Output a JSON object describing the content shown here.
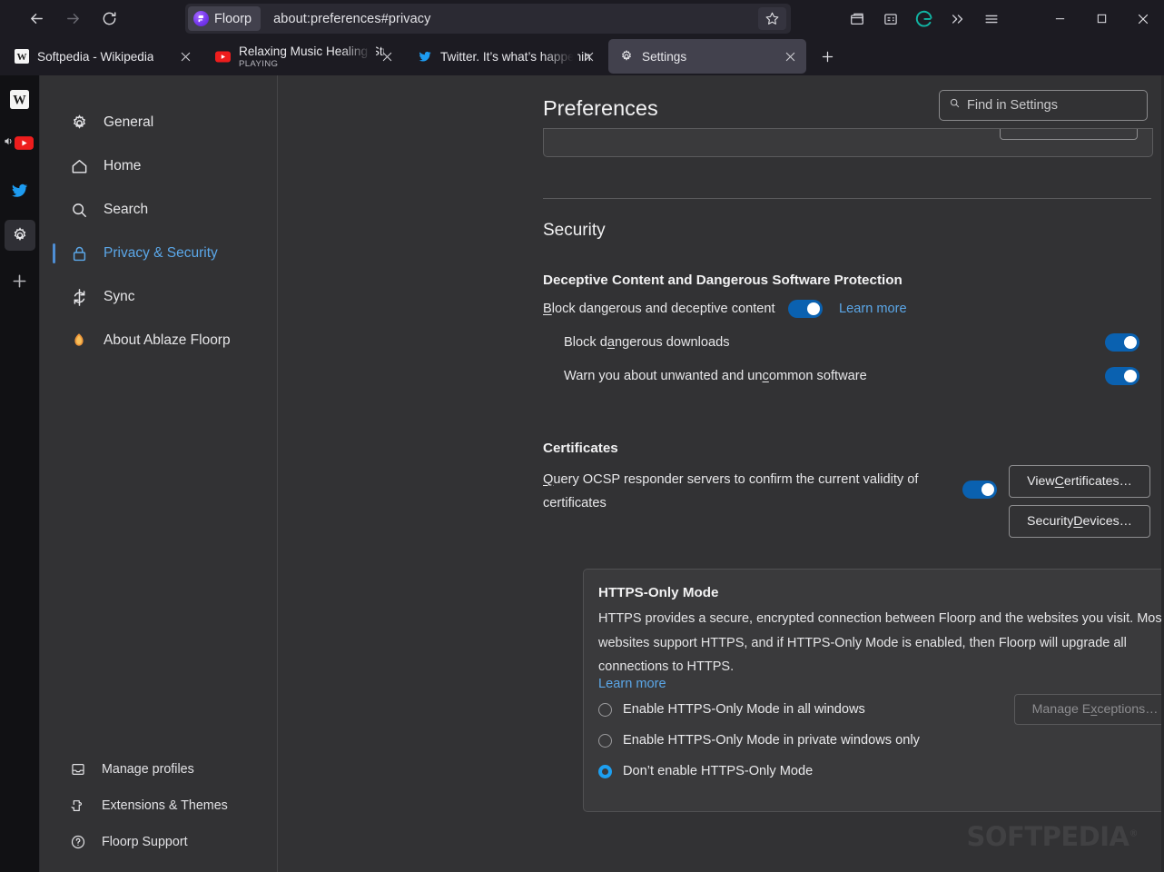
{
  "window": {
    "controls": {
      "minimize": "—",
      "maximize": "□",
      "close": "✕"
    }
  },
  "navbar": {
    "back_icon": "back-arrow-icon",
    "forward_icon": "forward-arrow-icon",
    "reload_icon": "reload-icon",
    "identity_chip_label": "Floorp",
    "url": "about:preferences#privacy",
    "bookmark_icon": "star-icon",
    "toolbar_icons": [
      "container-tabs-icon",
      "save-to-pocket-icon",
      "grammarly-icon",
      "overflow-chevrons-icon",
      "hamburger-menu-icon"
    ]
  },
  "tabs": [
    {
      "title": "Softpedia - Wikipedia",
      "subtitle": "",
      "favicon": "wikipedia-icon",
      "active": false
    },
    {
      "title": "Relaxing Music Healing Stress, A",
      "subtitle": "PLAYING",
      "favicon": "youtube-icon",
      "active": false
    },
    {
      "title": "Twitter. It’s what’s happening / T",
      "subtitle": "",
      "favicon": "twitter-icon",
      "active": false
    },
    {
      "title": "Settings",
      "subtitle": "",
      "favicon": "gear-icon",
      "active": true
    }
  ],
  "new_tab_label": "+",
  "app_sidebar": [
    {
      "icon": "wikipedia-icon",
      "selected": false
    },
    {
      "icon": "youtube-playing-icon",
      "selected": false
    },
    {
      "icon": "twitter-icon",
      "selected": false
    },
    {
      "icon": "gear-icon",
      "selected": true
    },
    {
      "icon": "plus-icon",
      "selected": false
    }
  ],
  "prefs_nav": {
    "items": [
      {
        "label": "General",
        "icon": "gear-icon",
        "active": false
      },
      {
        "label": "Home",
        "icon": "home-icon",
        "active": false
      },
      {
        "label": "Search",
        "icon": "search-icon",
        "active": false
      },
      {
        "label": "Privacy & Security",
        "icon": "lock-icon",
        "active": true
      },
      {
        "label": "Sync",
        "icon": "sync-icon",
        "active": false
      },
      {
        "label": "About Ablaze Floorp",
        "icon": "floorp-flame-icon",
        "active": false
      }
    ],
    "bottom_items": [
      {
        "label": "Manage profiles",
        "icon": "profiles-icon"
      },
      {
        "label": "Extensions & Themes",
        "icon": "extensions-icon"
      },
      {
        "label": "Floorp Support",
        "icon": "help-circle-icon"
      }
    ]
  },
  "header": {
    "title": "Preferences",
    "search_placeholder": "Find in Settings",
    "search_value": "",
    "search_icon": "search-icon"
  },
  "security": {
    "heading": "Security",
    "deceptive": {
      "heading": "Deceptive Content and Dangerous Software Protection",
      "main_label_pre": "B",
      "main_label_rest": "lock dangerous and deceptive content",
      "main_toggle_on": true,
      "learn_more": "Learn more",
      "sub_rows": [
        {
          "label_pre": "Block d",
          "label_key": "a",
          "label_post": "ngerous downloads",
          "on": true
        },
        {
          "label_pre": "Warn you about unwanted and un",
          "label_key": "c",
          "label_post": "ommon software",
          "on": true
        }
      ]
    },
    "certificates": {
      "heading": "Certificates",
      "ocsp_pre": "Q",
      "ocsp_rest": "uery OCSP responder servers to confirm the current validity of certificates",
      "ocsp_toggle_on": true,
      "view_certificates_pre": "View ",
      "view_certificates_key": "C",
      "view_certificates_post": "ertificates…",
      "security_devices_pre": "Security ",
      "security_devices_key": "D",
      "security_devices_post": "evices…"
    }
  },
  "https_only": {
    "heading": "HTTPS-Only Mode",
    "description": "HTTPS provides a secure, encrypted connection between Floorp and the websites you visit. Most websites support HTTPS, and if HTTPS-Only Mode is enabled, then Floorp will upgrade all connections to HTTPS.",
    "learn_more": "Learn more",
    "options": [
      {
        "label": "Enable HTTPS-Only Mode in all windows",
        "selected": false
      },
      {
        "label": "Enable HTTPS-Only Mode in private windows only",
        "selected": false
      },
      {
        "label": "Don’t enable HTTPS-Only Mode",
        "selected": true
      }
    ],
    "manage_exceptions_pre": "Manage E",
    "manage_exceptions_key": "x",
    "manage_exceptions_post": "ceptions…",
    "manage_exceptions_disabled": true
  },
  "watermark": {
    "text": "SOFTPEDIA",
    "mark": "®"
  },
  "colors": {
    "chrome_bg": "#1c1b22",
    "active_tab": "#42414d",
    "content_bg": "#323234",
    "card_bg": "#3a3a3c",
    "accent_blue": "#0a61b0",
    "link_blue": "#5ba7e8",
    "radio_blue": "#1d9ff0",
    "sidebar_black": "#111114"
  }
}
